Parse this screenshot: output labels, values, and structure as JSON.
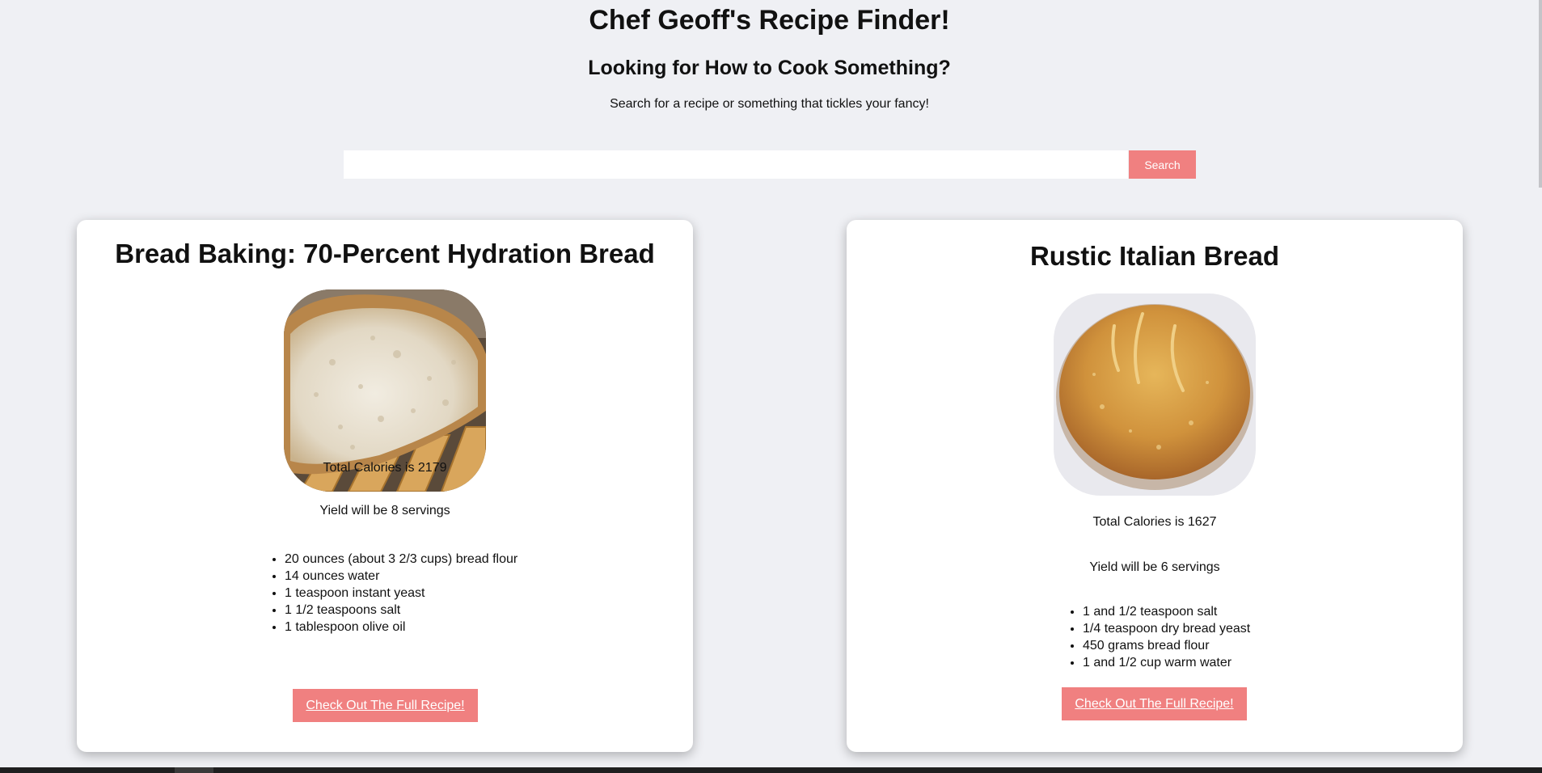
{
  "header": {
    "title": "Chef Geoff's Recipe Finder!",
    "subtitle": "Looking for How to Cook Something?",
    "tagline": "Search for a recipe or something that tickles your fancy!"
  },
  "search": {
    "value": "",
    "placeholder": "",
    "button_label": "Search"
  },
  "recipes": [
    {
      "title": "Bread Baking: 70-Percent Hydration Bread",
      "image": "bread-loaf-cut-photo",
      "calories": "Total Calories is 2179",
      "yield": "Yield will be 8 servings",
      "ingredients": [
        "20 ounces (about 3 2/3 cups) bread flour",
        "14 ounces water",
        "1 teaspoon instant yeast",
        "1 1/2 teaspoons salt",
        "1 tablespoon olive oil"
      ],
      "link_label": "Check Out The Full Recipe!"
    },
    {
      "title": "Rustic Italian Bread",
      "image": "round-rustic-loaf-photo",
      "calories": "Total Calories is 1627",
      "yield": "Yield will be 6 servings",
      "ingredients": [
        "1 and 1/2 teaspoon salt",
        "1/4 teaspoon dry bread yeast",
        "450 grams bread flour",
        "1 and 1/2 cup warm water"
      ],
      "link_label": "Check Out The Full Recipe!"
    }
  ],
  "colors": {
    "page_background": "#eff0f4",
    "accent": "#f08080",
    "card_background": "#ffffff"
  }
}
